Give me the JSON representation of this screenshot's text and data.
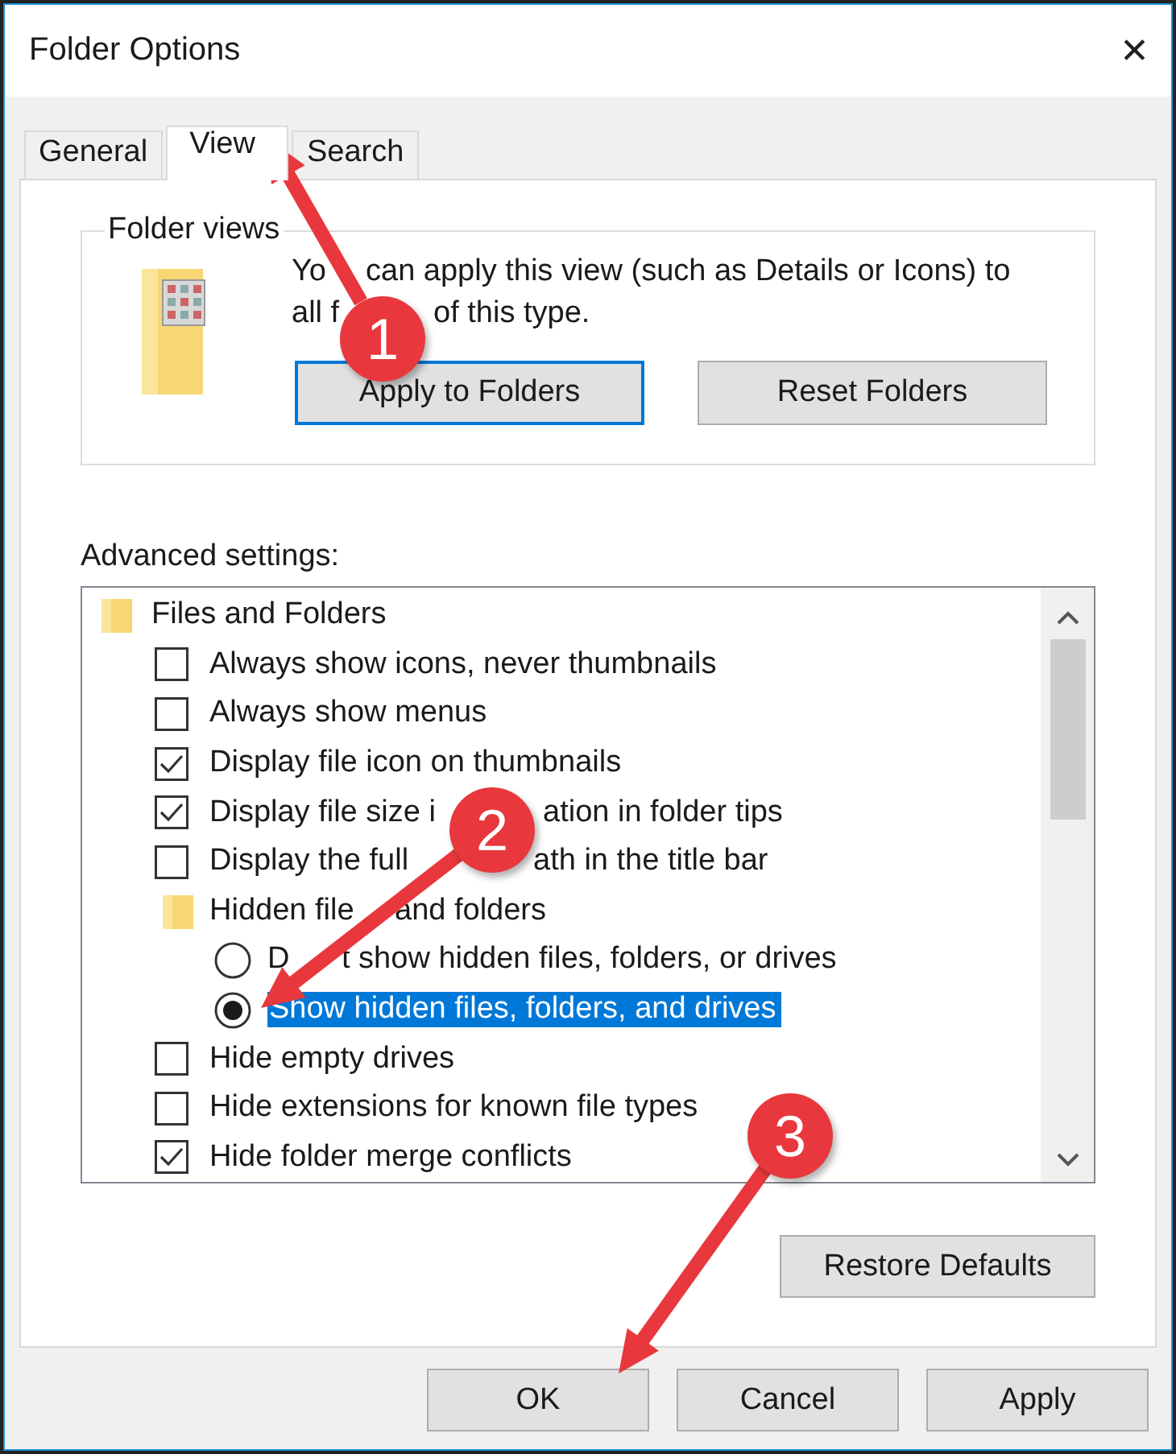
{
  "window": {
    "title": "Folder Options",
    "close": "✕"
  },
  "tabs": [
    {
      "label": "General",
      "selected": false
    },
    {
      "label": "View",
      "selected": true
    },
    {
      "label": "Search",
      "selected": false
    }
  ],
  "folder_views": {
    "legend": "Folder views",
    "description": [
      [
        "Yo",
        "can apply this view (such as Details or Icons) to"
      ],
      [
        "all f",
        "of this type."
      ]
    ],
    "buttons": [
      {
        "label": "Apply to Folders",
        "focused": true
      },
      {
        "label": "Reset Folders",
        "focused": false
      }
    ]
  },
  "advanced": {
    "label": "Advanced settings:",
    "tree": [
      {
        "kind": "group",
        "parts": [
          "Files and Folders"
        ],
        "selected": false,
        "children": [
          {
            "kind": "checkbox",
            "parts": [
              "Always show icons, never thumbnails"
            ],
            "checked": false,
            "selected": false
          },
          {
            "kind": "checkbox",
            "parts": [
              "Always show menus"
            ],
            "checked": false,
            "selected": false
          },
          {
            "kind": "checkbox",
            "parts": [
              "Display file icon on thumbnails"
            ],
            "checked": true,
            "selected": false
          },
          {
            "kind": "checkbox",
            "parts": [
              "Display file size i",
              "ation in folder tips"
            ],
            "checked": true,
            "selected": false
          },
          {
            "kind": "checkbox",
            "parts": [
              "Display the full",
              "ath in the title bar"
            ],
            "checked": false,
            "selected": false
          },
          {
            "kind": "group",
            "parts": [
              "Hidden file",
              "and folders"
            ],
            "selected": false,
            "children": [
              {
                "kind": "radio",
                "parts": [
                  "D",
                  "t show hidden files, folders, or drives"
                ],
                "checked": false,
                "selected": false
              },
              {
                "kind": "radio",
                "parts": [
                  "Show hidden files, folders, and drives"
                ],
                "checked": true,
                "selected": true
              }
            ]
          },
          {
            "kind": "checkbox",
            "parts": [
              "Hide empty drives"
            ],
            "checked": false,
            "selected": false
          },
          {
            "kind": "checkbox",
            "parts": [
              "Hide extensions for known file types"
            ],
            "checked": false,
            "selected": false
          },
          {
            "kind": "checkbox",
            "parts": [
              "Hide folder merge conflicts"
            ],
            "checked": true,
            "selected": false
          }
        ]
      }
    ],
    "restore": "Restore Defaults"
  },
  "buttons": [
    "OK",
    "Cancel",
    "Apply"
  ],
  "annotations": [
    "1",
    "2",
    "3"
  ]
}
